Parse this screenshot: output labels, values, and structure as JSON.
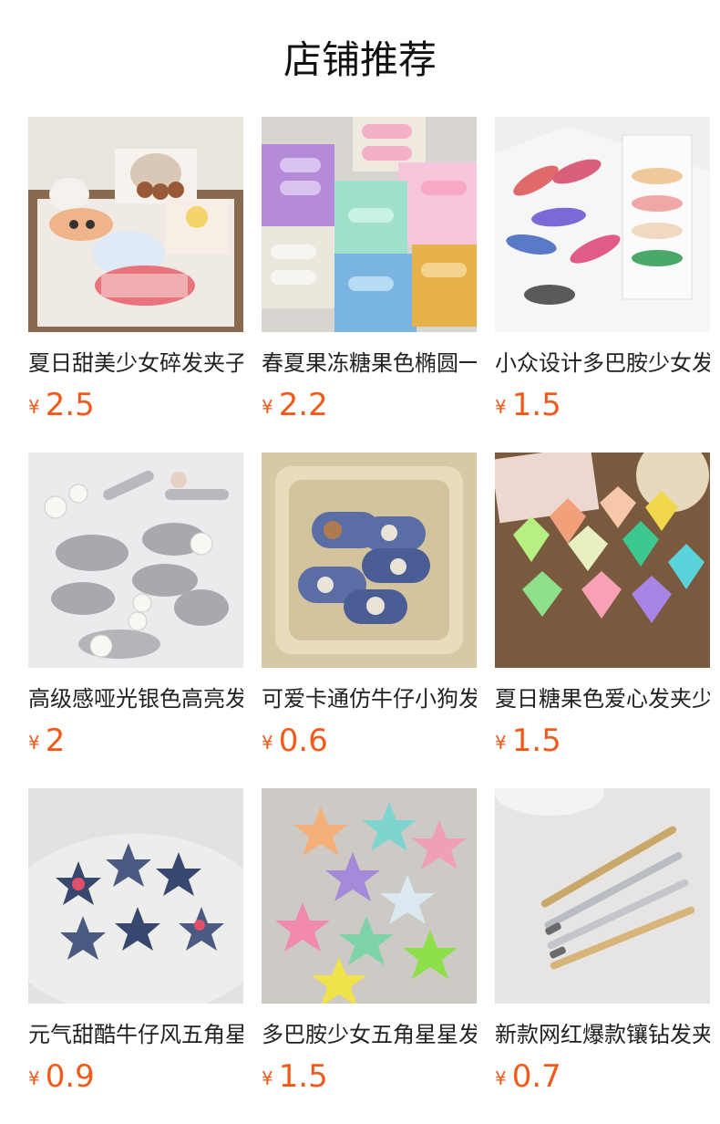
{
  "header": {
    "title": "店铺推荐"
  },
  "theme": {
    "price_color": "#f05a1a",
    "text_color": "#222222"
  },
  "products": [
    {
      "name": "夏日甜美少女碎发夹子",
      "currency": "¥",
      "price": "2.5",
      "image": "cartoon-bear-cloud-hair-clips"
    },
    {
      "name": "春夏果冻糖果色椭圆一字夹",
      "currency": "¥",
      "price": "2.2",
      "image": "pastel-oval-hair-clips"
    },
    {
      "name": "小众设计多巴胺少女发夹",
      "currency": "¥",
      "price": "1.5",
      "image": "glitter-duckbill-clips-card"
    },
    {
      "name": "高级感哑光银色高亮发夹",
      "currency": "¥",
      "price": "2",
      "image": "silver-pearl-hair-clips"
    },
    {
      "name": "可爱卡通仿牛仔小狗发夹",
      "currency": "¥",
      "price": "0.6",
      "image": "denim-puppy-hair-clips"
    },
    {
      "name": "夏日糖果色爱心发夹少女",
      "currency": "¥",
      "price": "1.5",
      "image": "candy-heart-hair-clips"
    },
    {
      "name": "元气甜酷牛仔风五角星发夹",
      "currency": "¥",
      "price": "0.9",
      "image": "denim-star-hair-clips"
    },
    {
      "name": "多巴胺少女五角星星发夹",
      "currency": "¥",
      "price": "1.5",
      "image": "pastel-star-hair-clips"
    },
    {
      "name": "新款网红爆款镶钻发夹",
      "currency": "¥",
      "price": "0.7",
      "image": "rhinestone-bar-hair-clips"
    }
  ]
}
